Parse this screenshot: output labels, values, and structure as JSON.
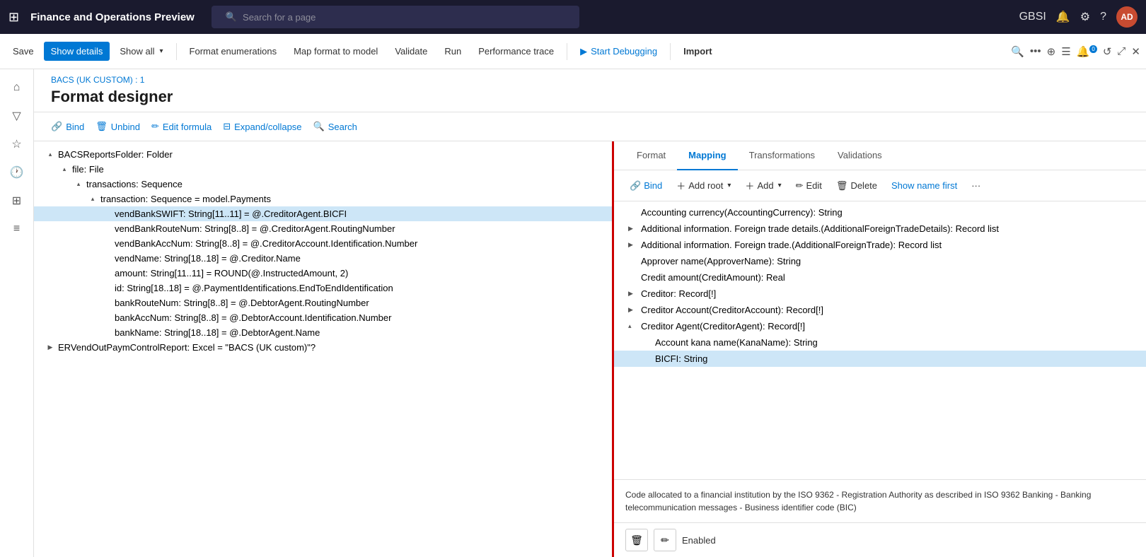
{
  "appTitle": "Finance and Operations Preview",
  "searchPlaceholder": "Search for a page",
  "topNav": {
    "userInitials": "AD",
    "userBg": "#c84b31",
    "region": "GBSI",
    "notifCount": "0"
  },
  "toolbar": {
    "saveLabel": "Save",
    "showDetailsLabel": "Show details",
    "showAllLabel": "Show all",
    "formatEnumsLabel": "Format enumerations",
    "mapFormatLabel": "Map format to model",
    "validateLabel": "Validate",
    "runLabel": "Run",
    "perfTraceLabel": "Performance trace",
    "startDebuggingLabel": "Start Debugging",
    "importLabel": "Import"
  },
  "breadcrumb": "BACS (UK CUSTOM) : 1",
  "pageTitle": "Format designer",
  "subToolbar": {
    "bindLabel": "Bind",
    "unbindLabel": "Unbind",
    "editFormulaLabel": "Edit formula",
    "expandCollapseLabel": "Expand/collapse",
    "searchLabel": "Search"
  },
  "tree": {
    "items": [
      {
        "indent": 0,
        "expand": "▴",
        "label": "BACSReportsFolder: Folder",
        "selected": false
      },
      {
        "indent": 1,
        "expand": "▴",
        "label": "file: File",
        "selected": false
      },
      {
        "indent": 2,
        "expand": "▴",
        "label": "transactions: Sequence",
        "selected": false
      },
      {
        "indent": 3,
        "expand": "▴",
        "label": "transaction: Sequence = model.Payments",
        "selected": false
      },
      {
        "indent": 4,
        "expand": "",
        "label": "vendBankSWIFT: String[11..11] = @.CreditorAgent.BICFI",
        "selected": true
      },
      {
        "indent": 4,
        "expand": "",
        "label": "vendBankRouteNum: String[8..8] = @.CreditorAgent.RoutingNumber",
        "selected": false
      },
      {
        "indent": 4,
        "expand": "",
        "label": "vendBankAccNum: String[8..8] = @.CreditorAccount.Identification.Number",
        "selected": false
      },
      {
        "indent": 4,
        "expand": "",
        "label": "vendName: String[18..18] = @.Creditor.Name",
        "selected": false
      },
      {
        "indent": 4,
        "expand": "",
        "label": "amount: String[11..11] = ROUND(@.InstructedAmount, 2)",
        "selected": false
      },
      {
        "indent": 4,
        "expand": "",
        "label": "id: String[18..18] = @.PaymentIdentifications.EndToEndIdentification",
        "selected": false
      },
      {
        "indent": 4,
        "expand": "",
        "label": "bankRouteNum: String[8..8] = @.DebtorAgent.RoutingNumber",
        "selected": false
      },
      {
        "indent": 4,
        "expand": "",
        "label": "bankAccNum: String[8..8] = @.DebtorAccount.Identification.Number",
        "selected": false
      },
      {
        "indent": 4,
        "expand": "",
        "label": "bankName: String[18..18] = @.DebtorAgent.Name",
        "selected": false
      },
      {
        "indent": 0,
        "expand": "▶",
        "label": "ERVendOutPaymControlReport: Excel = \"BACS (UK custom)\"?",
        "selected": false
      }
    ]
  },
  "rightPanel": {
    "tabs": [
      {
        "id": "format",
        "label": "Format",
        "active": false
      },
      {
        "id": "mapping",
        "label": "Mapping",
        "active": true
      },
      {
        "id": "transformations",
        "label": "Transformations",
        "active": false
      },
      {
        "id": "validations",
        "label": "Validations",
        "active": false
      }
    ],
    "toolbar": {
      "bindLabel": "Bind",
      "addRootLabel": "Add root",
      "addLabel": "Add",
      "editLabel": "Edit",
      "deleteLabel": "Delete",
      "showNameFirstLabel": "Show name first",
      "moreLabel": "···"
    },
    "treeItems": [
      {
        "indent": 0,
        "expand": "",
        "label": "Accounting currency(AccountingCurrency): String",
        "selected": false
      },
      {
        "indent": 0,
        "expand": "▶",
        "label": "Additional information. Foreign trade details.(AdditionalForeignTradeDetails): Record list",
        "selected": false
      },
      {
        "indent": 0,
        "expand": "▶",
        "label": "Additional information. Foreign trade.(AdditionalForeignTrade): Record list",
        "selected": false
      },
      {
        "indent": 0,
        "expand": "",
        "label": "Approver name(ApproverName): String",
        "selected": false
      },
      {
        "indent": 0,
        "expand": "",
        "label": "Credit amount(CreditAmount): Real",
        "selected": false
      },
      {
        "indent": 0,
        "expand": "▶",
        "label": "Creditor: Record[!]",
        "selected": false
      },
      {
        "indent": 0,
        "expand": "▶",
        "label": "Creditor Account(CreditorAccount): Record[!]",
        "selected": false
      },
      {
        "indent": 0,
        "expand": "▴",
        "label": "Creditor Agent(CreditorAgent): Record[!]",
        "selected": false
      },
      {
        "indent": 1,
        "expand": "",
        "label": "Account kana name(KanaName): String",
        "selected": false
      },
      {
        "indent": 1,
        "expand": "",
        "label": "BICFI: String",
        "selected": true
      }
    ],
    "descriptionText": "Code allocated to a financial institution by the ISO 9362 - Registration Authority as described in ISO 9362 Banking - Banking telecommunication messages - Business identifier code (BIC)",
    "statusLabel": "Enabled"
  }
}
